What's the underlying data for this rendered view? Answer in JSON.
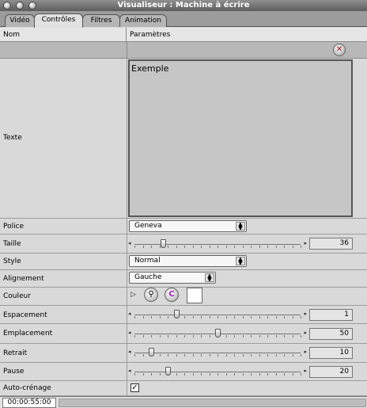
{
  "window": {
    "title": "Visualiseur : Machine à écrire"
  },
  "tabs": [
    {
      "label": "Vidéo"
    },
    {
      "label": "Contrôles",
      "active": true
    },
    {
      "label": "Filtres"
    },
    {
      "label": "Animation"
    }
  ],
  "header": {
    "col_name": "Nom",
    "col_params": "Paramètres"
  },
  "toolbar": {
    "reset_icon": "x-icon"
  },
  "params": {
    "texte": {
      "label": "Texte",
      "value": "Exemple"
    },
    "police": {
      "label": "Police",
      "value": "Geneva"
    },
    "taille": {
      "label": "Taille",
      "value": "36",
      "position": 0.17
    },
    "style": {
      "label": "Style",
      "value": "Normal"
    },
    "alignement": {
      "label": "Alignement",
      "value": "Gauche"
    },
    "couleur": {
      "label": "Couleur",
      "swatch": "#ffffff"
    },
    "espacement": {
      "label": "Espacement",
      "value": "1",
      "position": 0.25
    },
    "emplacement": {
      "label": "Emplacement",
      "value": "50",
      "position": 0.5
    },
    "retrait": {
      "label": "Retrait",
      "value": "10",
      "position": 0.1
    },
    "pause": {
      "label": "Pause",
      "value": "20",
      "position": 0.2
    },
    "auto_crenage": {
      "label": "Auto-crénage",
      "checked": true
    }
  },
  "status": {
    "timecode": "00:00:55:00"
  }
}
